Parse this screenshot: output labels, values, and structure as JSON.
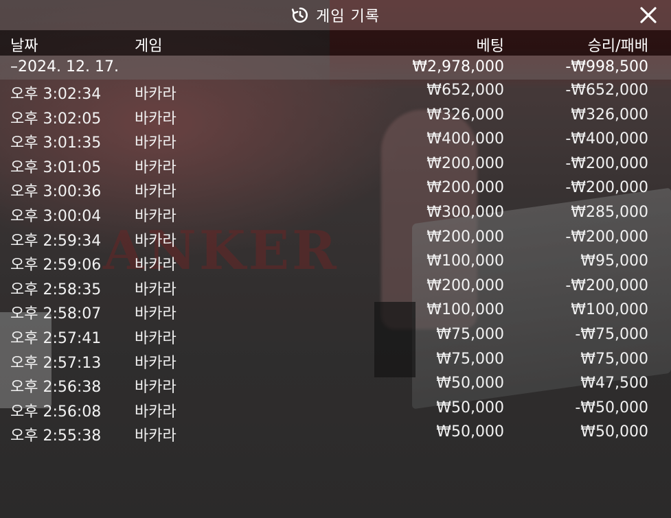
{
  "header": {
    "title": "게임 기록",
    "close_label": "✕"
  },
  "columns": {
    "date": "날짜",
    "game": "게임",
    "bet": "베팅",
    "result": "승리/패배"
  },
  "date_group": {
    "date": "–2024. 12. 17.",
    "total_bet": "₩2,978,000",
    "total_result": "-₩998,500"
  },
  "rows": [
    {
      "time": "오후 3:02:34",
      "game": "바카라",
      "bet": "₩652,000",
      "result": "-₩652,000"
    },
    {
      "time": "오후 3:02:05",
      "game": "바카라",
      "bet": "₩326,000",
      "result": "₩326,000"
    },
    {
      "time": "오후 3:01:35",
      "game": "바카라",
      "bet": "₩400,000",
      "result": "-₩400,000"
    },
    {
      "time": "오후 3:01:05",
      "game": "바카라",
      "bet": "₩200,000",
      "result": "-₩200,000"
    },
    {
      "time": "오후 3:00:36",
      "game": "바카라",
      "bet": "₩200,000",
      "result": "-₩200,000"
    },
    {
      "time": "오후 3:00:04",
      "game": "바카라",
      "bet": "₩300,000",
      "result": "₩285,000"
    },
    {
      "time": "오후 2:59:34",
      "game": "바카라",
      "bet": "₩200,000",
      "result": "-₩200,000"
    },
    {
      "time": "오후 2:59:06",
      "game": "바카라",
      "bet": "₩100,000",
      "result": "₩95,000"
    },
    {
      "time": "오후 2:58:35",
      "game": "바카라",
      "bet": "₩200,000",
      "result": "-₩200,000"
    },
    {
      "time": "오후 2:58:07",
      "game": "바카라",
      "bet": "₩100,000",
      "result": "₩100,000"
    },
    {
      "time": "오후 2:57:41",
      "game": "바카라",
      "bet": "₩75,000",
      "result": "-₩75,000"
    },
    {
      "time": "오후 2:57:13",
      "game": "바카라",
      "bet": "₩75,000",
      "result": "₩75,000"
    },
    {
      "time": "오후 2:56:38",
      "game": "바카라",
      "bet": "₩50,000",
      "result": "₩47,500"
    },
    {
      "time": "오후 2:56:08",
      "game": "바카라",
      "bet": "₩50,000",
      "result": "-₩50,000"
    },
    {
      "time": "오후 2:55:38",
      "game": "바카라",
      "bet": "₩50,000",
      "result": "₩50,000"
    }
  ],
  "background": {
    "table_text": "ANKER"
  },
  "icons": {
    "title_icon": "history-icon",
    "close_icon": "close-icon"
  }
}
